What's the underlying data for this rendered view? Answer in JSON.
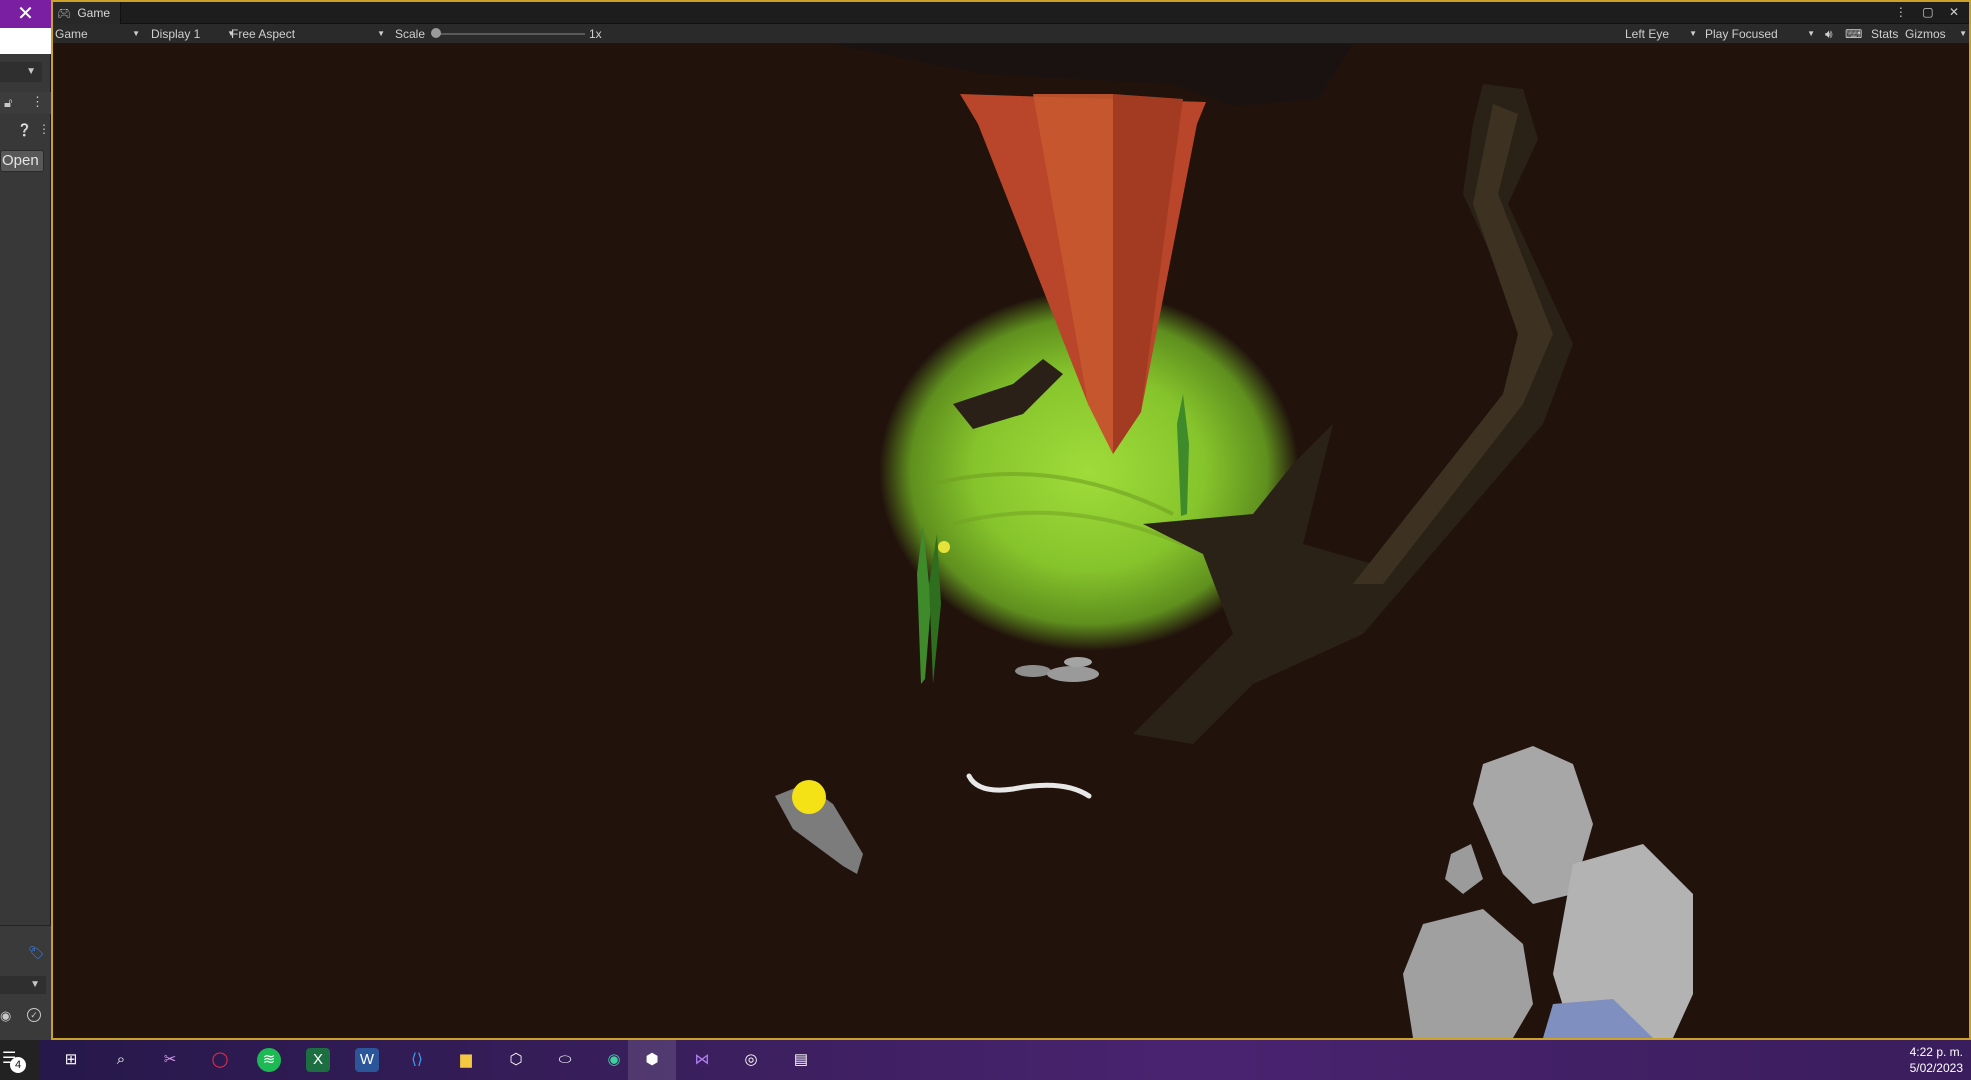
{
  "left_panel": {
    "close_glyph": "✕",
    "open_button": "Open",
    "notification_count": "4"
  },
  "game_window": {
    "tab_title": "Game",
    "toolbar": {
      "mode": "Game",
      "display": "Display 1",
      "aspect": "Free Aspect",
      "scale_label": "Scale",
      "scale_value": "1x",
      "eye": "Left Eye",
      "play_mode": "Play Focused",
      "stats": "Stats",
      "gizmos": "Gizmos"
    }
  },
  "taskbar": {
    "apps": [
      "start-icon",
      "search-icon",
      "snip-icon",
      "opera-icon",
      "spotify-icon",
      "excel-icon",
      "word-icon",
      "vscode-icon",
      "file-explorer-icon",
      "unity-hub-icon",
      "oculus-icon",
      "gamepad-app-icon",
      "unity-icon",
      "visual-studio-icon",
      "obs-icon",
      "virtual-desktop-icon"
    ],
    "time": "4:22 p. m.",
    "date": "5/02/2023"
  },
  "colors": {
    "accent_purple": "#7a1fa2",
    "window_border": "#c9a227",
    "tunnel_brown": "#5a2d1c",
    "opening_green": "#9fdc3a",
    "cone_orange": "#c4532c"
  }
}
